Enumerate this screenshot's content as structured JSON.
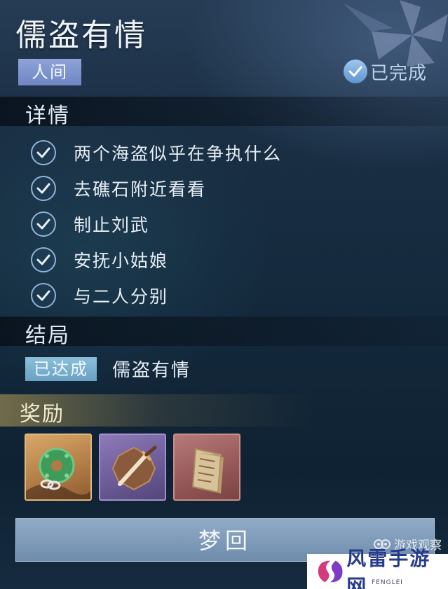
{
  "quest": {
    "title": "儒盗有情",
    "category": "人间",
    "status": "已完成"
  },
  "details": {
    "heading": "详情",
    "tasks": [
      {
        "text": "两个海盗似乎在争执什么",
        "done": true
      },
      {
        "text": "去礁石附近看看",
        "done": true
      },
      {
        "text": "制止刘武",
        "done": true
      },
      {
        "text": "安抚小姑娘",
        "done": true
      },
      {
        "text": "与二人分别",
        "done": true
      }
    ]
  },
  "ending": {
    "heading": "结局",
    "badge": "已达成",
    "name": "儒盗有情"
  },
  "rewards": {
    "heading": "奖励",
    "items": [
      {
        "icon": "jade-pendant-icon",
        "rarity": "gold"
      },
      {
        "icon": "dagger-icon",
        "rarity": "purple"
      },
      {
        "icon": "book-icon",
        "rarity": "red"
      }
    ]
  },
  "actions": {
    "dream_button": "梦回"
  },
  "watermarks": {
    "small": "游戏观察",
    "big": "风雷手游网",
    "big_sub": "FENGLEI"
  },
  "colors": {
    "category_badge": "#7f95ce",
    "ending_badge": "#7bb1d0",
    "reward_gold": "#c4915a",
    "reward_purple": "#7b69a8",
    "reward_red": "#a06464"
  }
}
